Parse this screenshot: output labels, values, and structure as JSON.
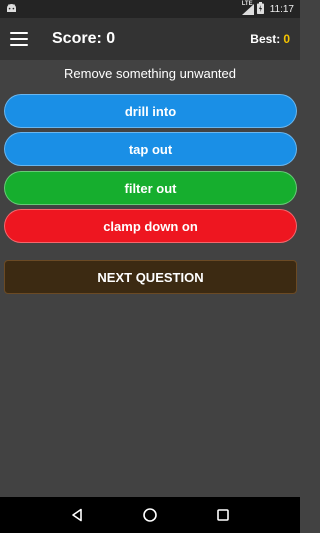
{
  "status_bar": {
    "time": "11:17",
    "network_label": "LTE",
    "battery_icon": "battery-charging-icon",
    "signal_icon": "cell-signal-icon",
    "notification_icon": "android-icon"
  },
  "app_bar": {
    "menu_icon": "hamburger-menu-icon",
    "score_text": "Score: 0",
    "best_label": "Best:",
    "best_value": "0"
  },
  "question": {
    "prompt": "Remove something unwanted"
  },
  "answers": [
    {
      "label": "drill into",
      "color": "#1a8fe6"
    },
    {
      "label": "tap out",
      "color": "#1a8fe6"
    },
    {
      "label": "filter out",
      "color": "#16ae2e"
    },
    {
      "label": "clamp down on",
      "color": "#ee1620"
    }
  ],
  "next_button": {
    "label": "NEXT QUESTION",
    "color": "#3c2a12"
  },
  "nav_bar": {
    "back_icon": "back-triangle-icon",
    "home_icon": "home-circle-icon",
    "recents_icon": "recents-square-icon"
  },
  "colors": {
    "background": "#424242",
    "app_bar": "#333333",
    "best_value": "#f5c400"
  }
}
